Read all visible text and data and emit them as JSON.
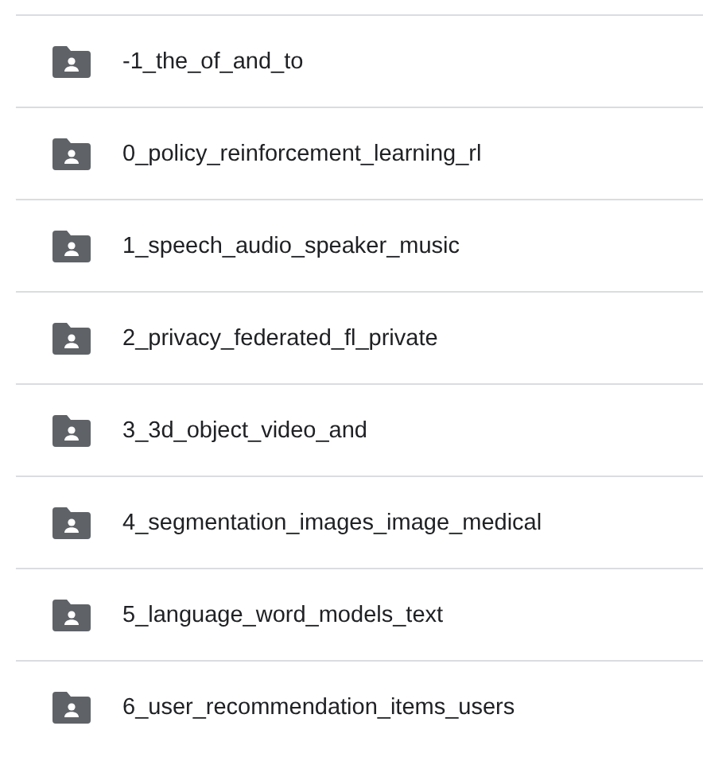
{
  "folders": [
    {
      "name": "-1_the_of_and_to"
    },
    {
      "name": "0_policy_reinforcement_learning_rl"
    },
    {
      "name": "1_speech_audio_speaker_music"
    },
    {
      "name": "2_privacy_federated_fl_private"
    },
    {
      "name": "3_3d_object_video_and"
    },
    {
      "name": "4_segmentation_images_image_medical"
    },
    {
      "name": "5_language_word_models_text"
    },
    {
      "name": "6_user_recommendation_items_users"
    }
  ]
}
